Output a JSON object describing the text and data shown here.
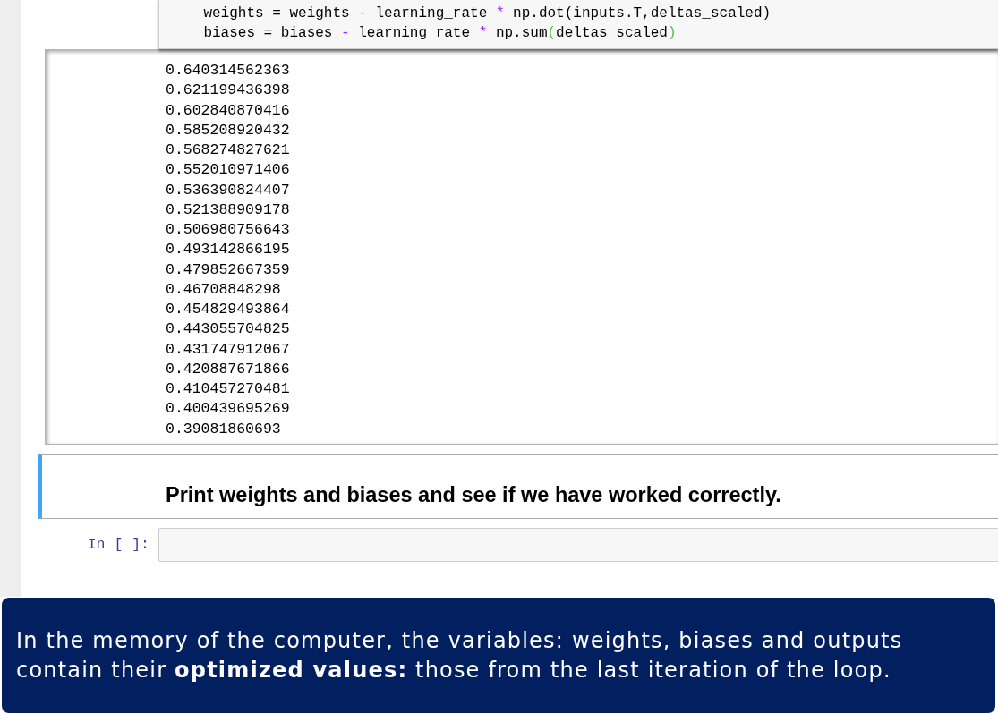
{
  "code_cell": {
    "lines": [
      [
        {
          "text": "    weights = weights ",
          "kind": "plain"
        },
        {
          "text": "-",
          "kind": "operator"
        },
        {
          "text": " learning_rate ",
          "kind": "plain"
        },
        {
          "text": "*",
          "kind": "operator"
        },
        {
          "text": " np.dot(inputs.T,deltas_scaled)",
          "kind": "plain"
        }
      ],
      [
        {
          "text": "    biases = biases ",
          "kind": "plain"
        },
        {
          "text": "-",
          "kind": "operator"
        },
        {
          "text": " learning_rate ",
          "kind": "plain"
        },
        {
          "text": "*",
          "kind": "operator"
        },
        {
          "text": " np.sum",
          "kind": "plain"
        },
        {
          "text": "(",
          "kind": "bracket"
        },
        {
          "text": "deltas_scaled",
          "kind": "plain"
        },
        {
          "text": ")",
          "kind": "bracket"
        }
      ]
    ]
  },
  "output": {
    "lines": [
      "0.640314562363",
      "0.621199436398",
      "0.602840870416",
      "0.585208920432",
      "0.568274827621",
      "0.552010971406",
      "0.536390824407",
      "0.521388909178",
      "0.506980756643",
      "0.493142866195",
      "0.479852667359",
      "0.46708848298",
      "0.454829493864",
      "0.443055704825",
      "0.431747912067",
      "0.420887671866",
      "0.410457270481",
      "0.400439695269",
      "0.39081860693"
    ]
  },
  "markdown_cell": {
    "text": "Print weights and biases and see if we have worked correctly.",
    "selected": true
  },
  "input_cell": {
    "prompt": "In [ ]:"
  },
  "caption": {
    "text": "In the memory of the computer, the variables: weights, biases and outputs contain their **optimized values:** those from the last iteration of the loop."
  }
}
